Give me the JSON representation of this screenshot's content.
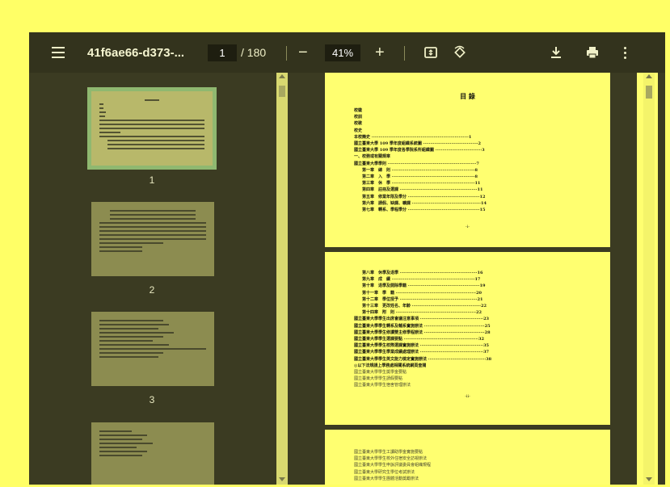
{
  "toolbar": {
    "title": "41f6ae66-d373-...",
    "current_page": "1",
    "total_pages": "/ 180",
    "zoom": "41%",
    "zoom_out": "−",
    "zoom_in": "+",
    "rotate": "⟲"
  },
  "sidebar": {
    "thumbnails": [
      {
        "label": "1",
        "selected": true
      },
      {
        "label": "2",
        "selected": false
      },
      {
        "label": "3",
        "selected": false
      },
      {
        "label": "",
        "selected": false
      }
    ]
  },
  "pages": {
    "page1": {
      "title": "目 錄",
      "lines": [
        "校徽",
        "校訓",
        "校歌",
        "校史",
        "本校簡史 ·····································································1",
        "國立臺東大學 109 學年度組織系統圖 ·······································2",
        "國立臺東大學 109 學年度各學院系所組織圖 ·································3",
        "一、校務或有關規章",
        "國立臺東大學學則 ·······························································7",
        "　　第一章　總　則 ···························································8",
        "　　第二章　入　學 ···························································8",
        "　　第三章　休　學 ···························································11",
        "　　第四章　註冊及選課 ·······················································11",
        "　　第五章　修業年限及學分 ···················································12",
        "　　第六章　請假、缺課、曠課 ·················································14",
        "　　第七章　轉系、學程學分 ···················································15"
      ],
      "number": "-i-"
    },
    "page2": {
      "lines": [
        "　　第八章　休學及退學 ·······················································16",
        "　　第九章　成　績 ···························································17",
        "　　第十章　退學及開除學籍 ···················································19",
        "　　第十一章　學　籍 ·························································20",
        "　　第十二章　學位授予 ·······················································21",
        "　　第十三章　更改姓名、年齡 ·················································22",
        "　　第十四章　附　則 ·························································22",
        "國立臺東大學學生出席會議注意事項 ·············································23",
        "國立臺東大學學生轉系及輔系實施辦法 ···········································25",
        "國立臺東大學學生修讀雙主修學程辦法 ···········································28",
        "國立臺東大學學生選課要點 ·····················································32",
        "國立臺東大學學生校際選課實施辦法 ·············································35",
        "國立臺東大學學生學業成績處理辦法 ·············································37",
        "國立臺東大學學生英文能力檢定實施辦法 ·········································38",
        "◎以下法規請上學務處相關系統網頁查閱",
        "國立臺東大學學生獎學金要點",
        "國立臺東大學學生請假要點",
        "國立臺東大學學生宿舍管理辦法"
      ],
      "number": "-ii-"
    },
    "page3": {
      "lines": [
        "國立臺東大學學生工讀助學金實施要點",
        "國立臺東大學學生校外住宿安全訪視辦法",
        "國立臺東大學學生申訴評議委員會組織規程",
        "國立臺東大學研究生學位考試辦法",
        "國立臺東大學學生團體活動獎勵辦法"
      ]
    }
  }
}
